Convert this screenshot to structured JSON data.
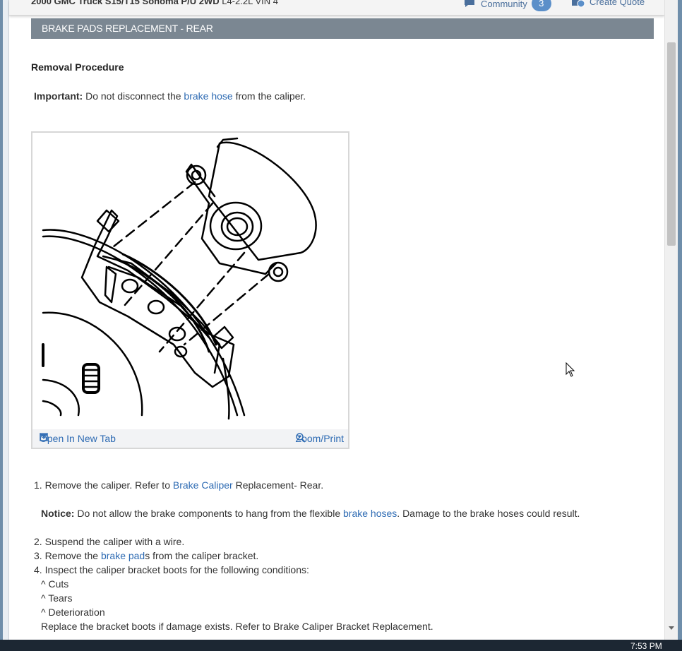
{
  "topbar": {
    "vehicle_bold": "2000 GMC Truck S15/T15 Sonoma P/U 2WD",
    "vehicle_rest": "L4-2.2L VIN 4",
    "community_label": "Community",
    "community_count": "3",
    "quote_label": "Create Quote"
  },
  "section": {
    "title": "BRAKE PADS REPLACEMENT - REAR",
    "procedure_heading": "Removal Procedure"
  },
  "important": {
    "label": "Important:",
    "text_before": "Do not disconnect the",
    "link": "brake hose",
    "text_after": "from the caliper."
  },
  "figure": {
    "open_label": "Open In New Tab",
    "zoom_label": "Zoom/Print"
  },
  "steps": {
    "s1_before": "1. Remove the caliper. Refer to",
    "s1_link": "Brake Caliper",
    "s1_after": "Replacement- Rear.",
    "notice_label": "Notice:",
    "notice_before": "Do not allow the brake components to hang from the flexible",
    "notice_link": "brake hoses",
    "notice_after": ". Damage to the brake hoses could result.",
    "s2": "2. Suspend the caliper with a wire.",
    "s3_before": "3. Remove the",
    "s3_link": "brake pad",
    "s3_after": "s from the caliper bracket.",
    "s4": "4. Inspect the caliper bracket boots for the following conditions:",
    "c1": "^  Cuts",
    "c2": "^  Tears",
    "c3": "^  Deterioration",
    "replace": "Replace the bracket boots if damage exists. Refer to Brake Caliper Bracket Replacement."
  },
  "taskbar": {
    "clock": "7:53 PM"
  },
  "colors": {
    "header_bg": "#7b8792",
    "link": "#2e6bb3",
    "badge": "#5b8fc9"
  }
}
